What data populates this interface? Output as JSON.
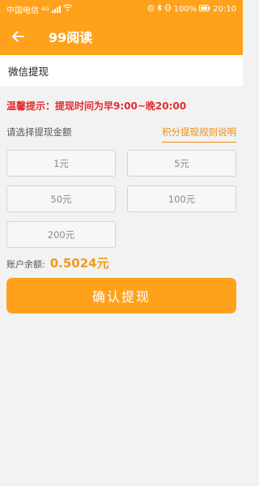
{
  "status_bar": {
    "carrier": "中国电信",
    "network": "4G",
    "battery": "100%",
    "time": "20:10"
  },
  "top_bar": {
    "title": "99阅读",
    "back_icon": "arrow-left-icon"
  },
  "withdraw_method": "微信提现",
  "tip": "温馨提示：提现时间为早9:00~晚20:00",
  "choose_label": "请选择提现金额",
  "rules_link": "积分提现规则说明",
  "amounts": [
    "1元",
    "5元",
    "50元",
    "100元",
    "200元"
  ],
  "balance": {
    "label": "账户余额:",
    "value": "0.5024元"
  },
  "confirm_button": "确认提现",
  "colors": {
    "primary": "#fea21b",
    "tip_red": "#e02d2d",
    "link_orange": "#ee8c10",
    "balance_orange": "#f39a1a",
    "background": "#f2f2f2"
  }
}
